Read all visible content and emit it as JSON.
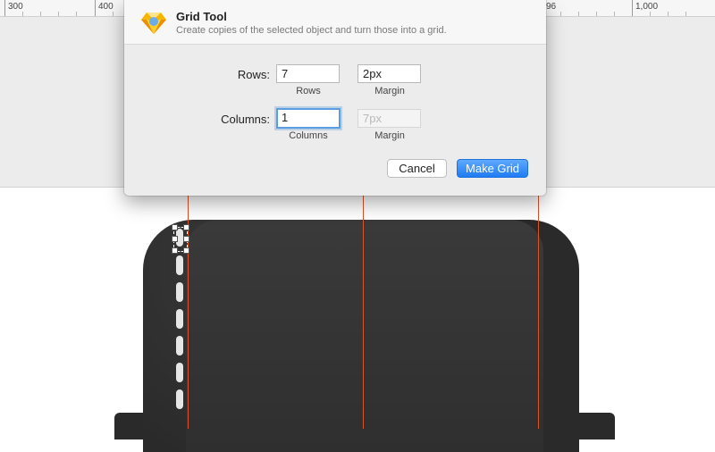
{
  "ruler": {
    "labels": [
      "300",
      "400",
      "96",
      "1,000"
    ]
  },
  "dialog": {
    "title": "Grid Tool",
    "subtitle": "Create copies of the selected object and turn those into a grid.",
    "rows_label": "Rows:",
    "rows_value": "7",
    "rows_caption": "Rows",
    "rows_margin_value": "2px",
    "rows_margin_caption": "Margin",
    "columns_label": "Columns:",
    "columns_value": "1",
    "columns_caption": "Columns",
    "columns_margin_placeholder": "7px",
    "columns_margin_caption": "Margin",
    "cancel_label": "Cancel",
    "make_grid_label": "Make Grid"
  },
  "colors": {
    "accent": "#1f7cf3",
    "guide": "#d9532c",
    "shape": "#2b2b2b"
  },
  "icons": {
    "app": "sketch-diamond-icon"
  }
}
